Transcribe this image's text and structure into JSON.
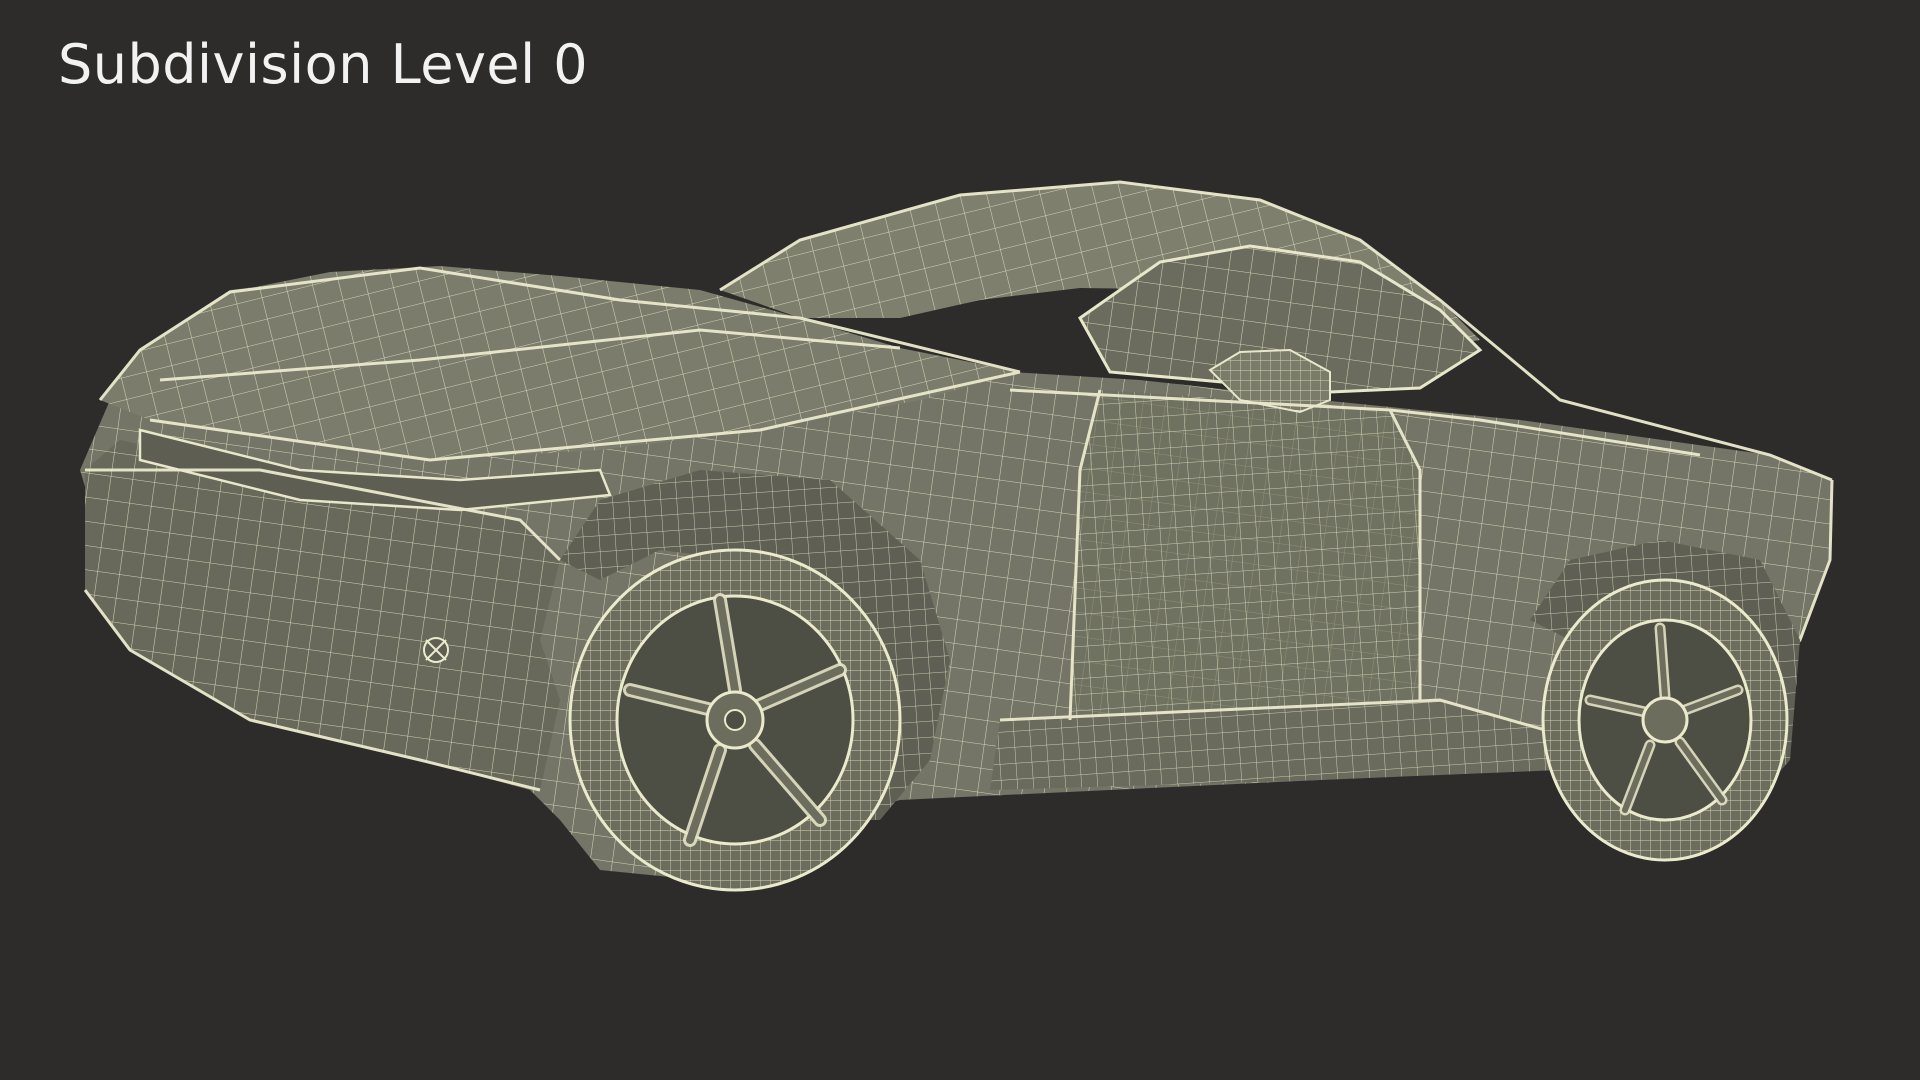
{
  "label": {
    "text": "Subdivision Level 0"
  },
  "colors": {
    "background": "#2d2c2b",
    "surface": "#747566",
    "surface_dark": "#5e5f52",
    "surface_light": "#83846f",
    "wire": "#e4e3c6",
    "text": "#f2f2f2"
  },
  "render": {
    "subject": "car-wireframe-icon"
  }
}
